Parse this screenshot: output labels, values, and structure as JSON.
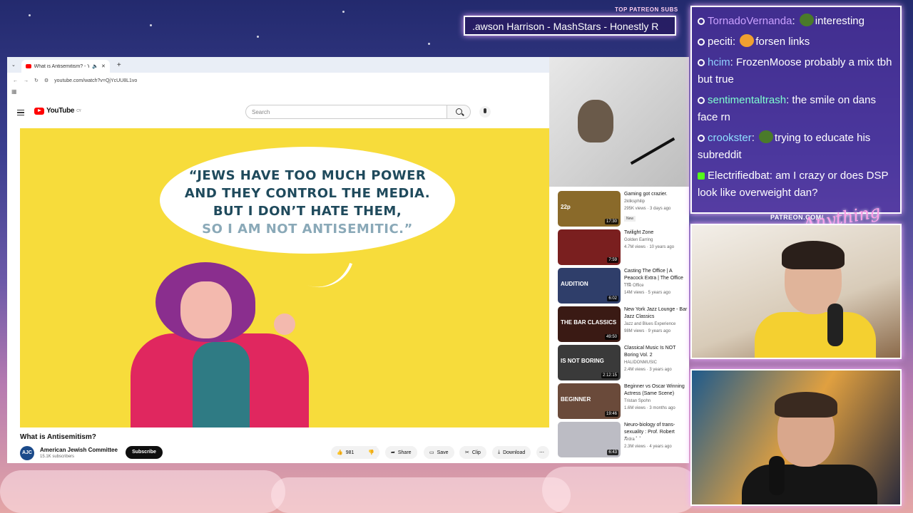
{
  "overlay": {
    "patreon_label": "TOP PATREON SUBS",
    "patreon_ticker": ".awson Harrison - MashStars - Honestly R",
    "patreon_url": "PATREON.COM/",
    "script_logo": "Anything"
  },
  "browser": {
    "tab_title": "What is Antisemitism? - Yo",
    "url": "youtube.com/watch?v=QjYcUU8L1vo",
    "search_placeholder": "Search",
    "yt_logo": "YouTube",
    "yt_country": "CY"
  },
  "video": {
    "quote_lines": [
      "“JEWS HAVE TOO MUCH POWER",
      "AND THEY CONTROL THE MEDIA.",
      "BUT I DON’T HATE THEM,",
      "SO I AM NOT ANTISEMITIC.”"
    ],
    "title": "What is Antisemitism?",
    "channel": "American Jewish Committee",
    "channel_avatar": "AJC",
    "subs": "15.1K subscribers",
    "subscribe": "Subscribe",
    "likes": "981",
    "share": "Share",
    "save": "Save",
    "clip": "Clip",
    "download": "Download"
  },
  "recommended": [
    {
      "title": "Gaming got crazier.",
      "channel": "2kliksphilip",
      "meta": "295K views · 3 days ago",
      "duration": "17:30",
      "badge": "New",
      "thumb_text": "22p",
      "color": "#8a6a2a"
    },
    {
      "title": "Twilight Zone",
      "channel": "Golden Earring",
      "meta": "4.7M views · 10 years ago",
      "duration": "7:59",
      "thumb_text": "",
      "color": "#7a1f1f"
    },
    {
      "title": "Casting The Office | A Peacock Extra | The Office US",
      "channel": "The Office",
      "meta": "14M views · 5 years ago",
      "duration": "6:02",
      "thumb_text": "AUDITION",
      "color": "#2f3e6a"
    },
    {
      "title": "New York Jazz Lounge - Bar Jazz Classics",
      "channel": "Jazz and Blues Experience",
      "meta": "98M views · 9 years ago",
      "duration": "49:50",
      "thumb_text": "THE BAR CLASSICS",
      "color": "#3a1a14"
    },
    {
      "title": "Classical Music Is NOT Boring Vol. 2",
      "channel": "HALIDONMUSIC",
      "meta": "2.4M views · 3 years ago",
      "duration": "2:12:15",
      "thumb_text": "IS NOT BORING",
      "color": "#3a3a3a"
    },
    {
      "title": "Beginner vs Oscar Winning Actress (Same Scene)",
      "channel": "Tristan Spohn",
      "meta": "1.6M views · 3 months ago",
      "duration": "19:46",
      "thumb_text": "BEGINNER",
      "color": "#6a4a3a"
    },
    {
      "title": "Neuro-biology of trans-sexuality : Prof. Robert Sapolsky",
      "channel": "Ardra",
      "meta": "2.3M views · 4 years ago",
      "duration": "6:43",
      "thumb_text": "",
      "color": "#bcbcc4"
    }
  ],
  "chat": [
    {
      "user": "TornadoVernanda",
      "color": "#c9a0ff",
      "text": "interesting",
      "emote": "#4a7a2a",
      "kick": false
    },
    {
      "user": "peciti",
      "color": "#ffffff",
      "text": "forsen links",
      "emote": "#f0a030",
      "kick": false
    },
    {
      "user": "hcim",
      "color": "#8fd0ff",
      "text": "FrozenMoose probably a mix tbh but true",
      "kick": false
    },
    {
      "user": "sentimentaltrash",
      "color": "#7fffd0",
      "text": "the smile on dans face rn",
      "kick": false
    },
    {
      "user": "crookster",
      "color": "#8fe0ff",
      "text": "trying to educate his subreddit",
      "emote": "#4a7a2a",
      "kick": false
    },
    {
      "user": "Electrifiedbat",
      "color": "#ffffff",
      "text": "am I crazy or does DSP look like overweight dan?",
      "kick": true
    }
  ]
}
